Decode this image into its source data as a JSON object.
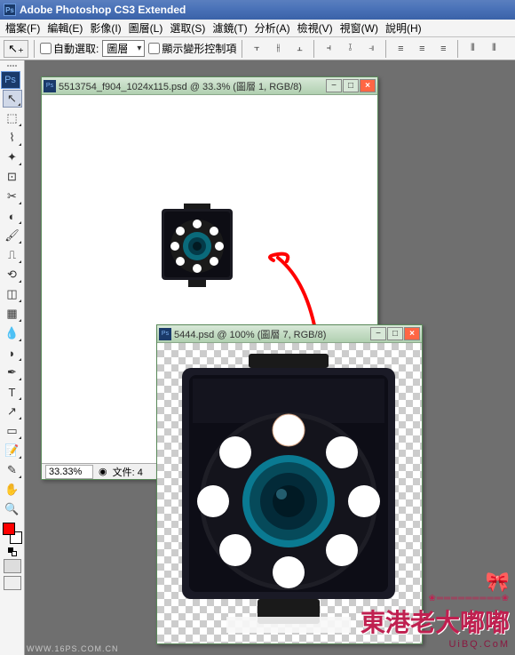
{
  "app": {
    "title": "Adobe Photoshop CS3 Extended",
    "ps_abbrev": "Ps"
  },
  "menu": {
    "file": "檔案(F)",
    "edit": "編輯(E)",
    "image": "影像(I)",
    "layer": "圖層(L)",
    "select": "選取(S)",
    "filter": "濾鏡(T)",
    "analysis": "分析(A)",
    "view": "檢視(V)",
    "window": "視窗(W)",
    "help": "說明(H)"
  },
  "options": {
    "auto_select_label": "自動選取:",
    "auto_select_value": "圖層",
    "show_transform_label": "顯示變形控制項"
  },
  "doc1": {
    "title": "5513754_f904_1024x115.psd @ 33.3% (圖層 1, RGB/8)",
    "zoom": "33.33%",
    "file_label": "文件: 4"
  },
  "doc2": {
    "title": "5444.psd @ 100% (圖層 7, RGB/8)"
  },
  "tools": {
    "move": "↖",
    "marquee": "⬚",
    "lasso": "⌇",
    "wand": "✦",
    "crop": "⊡",
    "slice": "✂",
    "heal": "◐",
    "brush": "🖌",
    "stamp": "⎍",
    "history": "⟲",
    "eraser": "◫",
    "gradient": "▦",
    "blur": "💧",
    "dodge": "◗",
    "pen": "✒",
    "type": "T",
    "path": "↗",
    "shape": "▭",
    "notes": "📝",
    "eyedrop": "✎",
    "hand": "✋",
    "zoom": "🔍"
  },
  "watermark": {
    "main": "東港老大嘟嘟",
    "sub": "UiBQ.CoM"
  },
  "footer": "WWW.16PS.COM.CN"
}
